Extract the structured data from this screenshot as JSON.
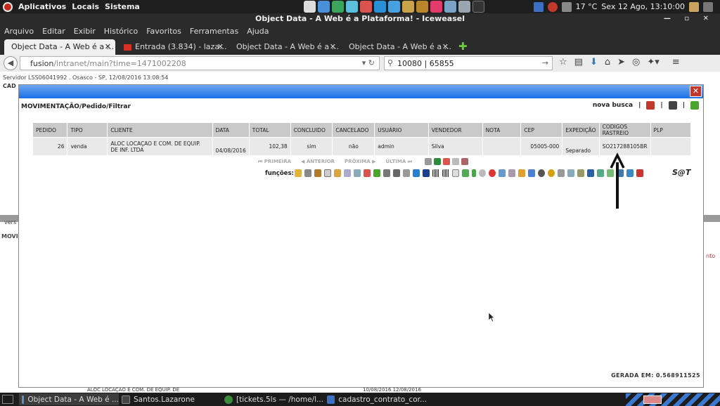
{
  "panel": {
    "apps_menu": "Aplicativos",
    "places_menu": "Locais",
    "system_menu": "Sistema",
    "weather": "17 °C",
    "clock": "Sex 12 Ago, 13:10:00"
  },
  "window": {
    "title": "Object Data - A Web é a Plataforma! - Iceweasel"
  },
  "menubar": [
    "Arquivo",
    "Editar",
    "Exibir",
    "Histórico",
    "Favoritos",
    "Ferramentas",
    "Ajuda"
  ],
  "tabs": [
    {
      "label": "Object Data - A Web é a ...",
      "active": true
    },
    {
      "label": "Entrada (3.834) - laza...",
      "active": false
    },
    {
      "label": "Object Data - A Web é a ...",
      "active": false
    },
    {
      "label": "Object Data - A Web é a ...",
      "active": false
    }
  ],
  "navbar": {
    "url_host": "fusion",
    "url_path": "/intranet/main?time=1471002208",
    "search_value": "10080 | 65855"
  },
  "background_page": {
    "server_info": "Servidor LSS06041992 . Osasco - SP, 12/08/2016 13:08:54",
    "cad_label": "CAD",
    "vers_label": "vers",
    "movi_label": "MOVI",
    "nto_label": "nto",
    "row_client": "ALOC LOCAÇAO E COM. DE EQUIP. DE",
    "row_dates": "10/08/2016 12/08/2016"
  },
  "modal": {
    "breadcrumb": "MOVIMENTAÇÃO/Pedido/Filtrar",
    "nova_busca": "nova busca",
    "columns": [
      "PEDIDO",
      "TIPO",
      "CLIENTE",
      "DATA",
      "TOTAL",
      "CONCLUIDO",
      "CANCELADO",
      "USUÁRIO",
      "VENDEDOR",
      "NOTA",
      "CEP",
      "EXPEDIÇÃO",
      "CODIGOS RASTREIO",
      "PLP"
    ],
    "rows": [
      {
        "pedido": "26",
        "tipo": "venda",
        "cliente": "ALOC LOCAÇAO E COM. DE EQUIP. DE INF. LTDA",
        "data": "04/08/2016",
        "total": "102,38",
        "concluido": "sim",
        "cancelado": "não",
        "usuario": "admin",
        "vendedor": "Silva",
        "nota": "",
        "cep": "05005-000",
        "expedicao": "Separado",
        "codigos_rastreio": "SO217288105BR",
        "plp": ""
      }
    ],
    "pager": {
      "primeira": "PRIMEIRA",
      "anterior": "ANTERIOR",
      "proxima": "PRÓXIMA",
      "ultima": "ÚLTIMA"
    },
    "funcoes_label": "funções:",
    "sat_label": "S@T",
    "gerada": "GERADA EM: 0.568911525"
  },
  "taskbar": [
    {
      "label": "Object Data - A Web é ...",
      "active": true
    },
    {
      "label": "Santos.Lazarone",
      "active": false
    },
    {
      "label": "[tickets.5ls — /home/l...",
      "active": false
    },
    {
      "label": "cadastro_contrato_cor...",
      "active": false
    }
  ]
}
